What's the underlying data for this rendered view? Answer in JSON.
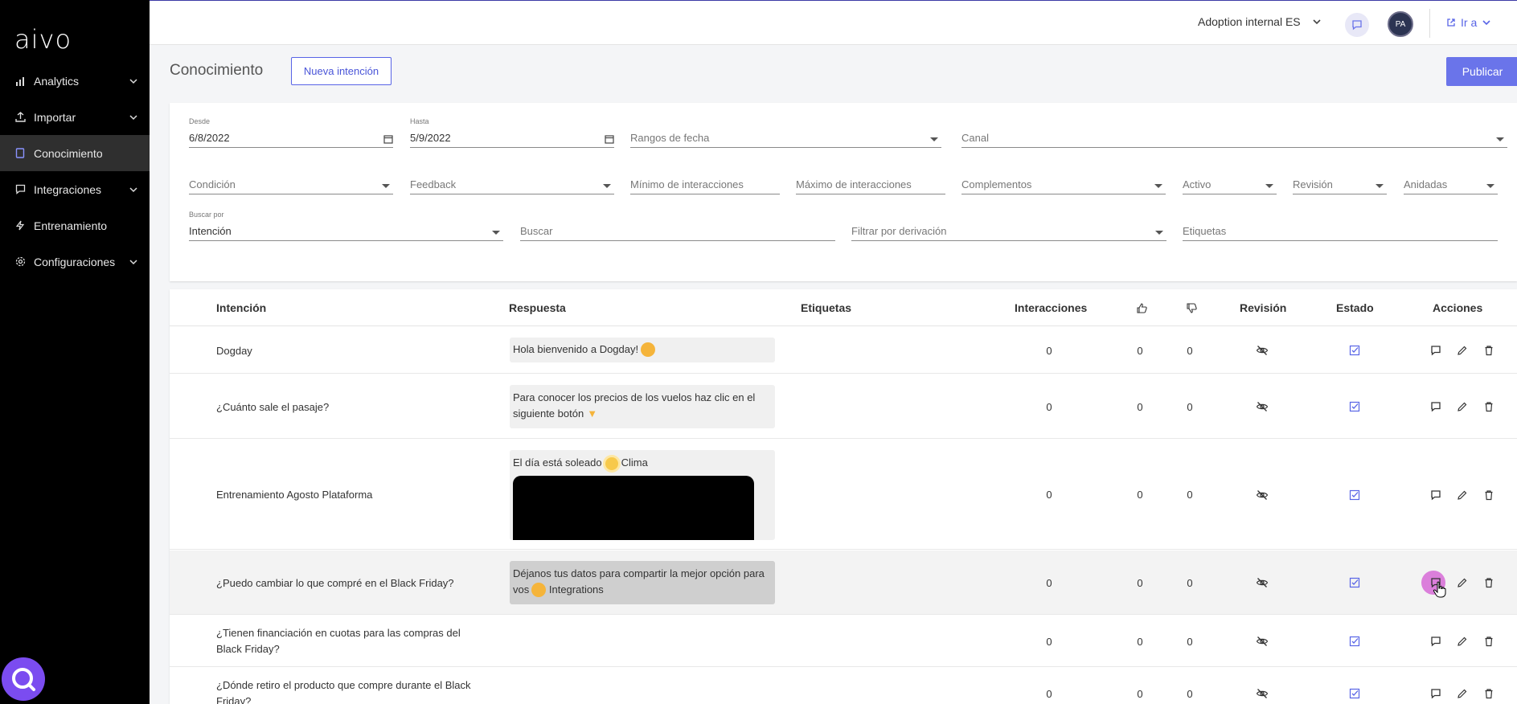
{
  "app": {
    "logo": "aivo",
    "org": "Adoption internal ES",
    "avatar": "PA",
    "goto": "Ir a"
  },
  "sidebar": {
    "items": [
      {
        "label": "Analytics",
        "icon": "bar-chart-icon",
        "chevron": true,
        "active": false
      },
      {
        "label": "Importar",
        "icon": "upload-icon",
        "chevron": true,
        "active": false
      },
      {
        "label": "Conocimiento",
        "icon": "book-icon",
        "chevron": false,
        "active": true
      },
      {
        "label": "Integraciones",
        "icon": "chat-icon",
        "chevron": true,
        "active": false
      },
      {
        "label": "Entrenamiento",
        "icon": "bolt-icon",
        "chevron": false,
        "active": false
      },
      {
        "label": "Configuraciones",
        "icon": "gear-icon",
        "chevron": true,
        "active": false
      }
    ]
  },
  "header": {
    "title": "Conocimiento",
    "new_intent": "Nueva intención",
    "publish": "Publicar"
  },
  "filters": {
    "desde_label": "Desde",
    "desde_value": "6/8/2022",
    "hasta_label": "Hasta",
    "hasta_value": "5/9/2022",
    "rangos": "Rangos de fecha",
    "canal": "Canal",
    "condicion": "Condición",
    "feedback": "Feedback",
    "min_inter": "Mínimo de interacciones",
    "max_inter": "Máximo de interacciones",
    "complementos": "Complementos",
    "activo": "Activo",
    "revision": "Revisión",
    "anidadas": "Anidadas",
    "buscar_por_label": "Buscar por",
    "buscar_por_value": "Intención",
    "buscar": "Buscar",
    "derivacion": "Filtrar por derivación",
    "etiquetas": "Etiquetas"
  },
  "table": {
    "headers": {
      "intencion": "Intención",
      "respuesta": "Respuesta",
      "etiquetas": "Etiquetas",
      "interacciones": "Interacciones",
      "revision": "Revisión",
      "estado": "Estado",
      "acciones": "Acciones"
    },
    "rows": [
      {
        "intent": "Dogday",
        "response": "Hola bienvenido a Dogday!",
        "interactions": "0",
        "likes": "0",
        "dislikes": "0"
      },
      {
        "intent": "¿Cuánto sale el pasaje?",
        "response": "Para conocer los precios de los vuelos haz clic en el siguiente botón",
        "interactions": "0",
        "likes": "0",
        "dislikes": "0"
      },
      {
        "intent": "Entrenamiento Agosto Plataforma",
        "response_a": "El día está soleado",
        "response_b": "Clima",
        "interactions": "0",
        "likes": "0",
        "dislikes": "0"
      },
      {
        "intent": "¿Puedo cambiar lo que compré en el Black Friday?",
        "response": "Déjanos tus datos para compartir la mejor opción para vos",
        "response_tag": "Integrations",
        "interactions": "0",
        "likes": "0",
        "dislikes": "0"
      },
      {
        "intent": "¿Tienen financiación en cuotas para las compras del Black Friday?",
        "interactions": "0",
        "likes": "0",
        "dislikes": "0"
      },
      {
        "intent": "¿Dónde retiro el producto que compre durante el Black Friday?",
        "interactions": "0",
        "likes": "0",
        "dislikes": "0"
      }
    ]
  },
  "colors": {
    "accent": "#5864e6",
    "sidebar_bg": "#000000",
    "publish_bg": "#6a74ea"
  }
}
